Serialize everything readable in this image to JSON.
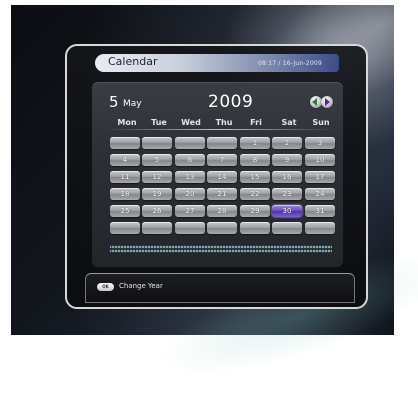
{
  "window": {
    "title": "Calendar",
    "clock": "08:17 / 16-Jun-2009"
  },
  "calendar": {
    "day": "5",
    "month": "May",
    "year": "2009",
    "weekdays": [
      "Mon",
      "Tue",
      "Wed",
      "Thu",
      "Fri",
      "Sat",
      "Sun"
    ],
    "weeks": [
      [
        "",
        "",
        "",
        "",
        "1",
        "2",
        "3"
      ],
      [
        "4",
        "5",
        "6",
        "7",
        "8",
        "9",
        "10"
      ],
      [
        "11",
        "12",
        "13",
        "14",
        "15",
        "16",
        "17"
      ],
      [
        "18",
        "19",
        "20",
        "21",
        "22",
        "23",
        "24"
      ],
      [
        "25",
        "26",
        "27",
        "28",
        "29",
        "30",
        "31"
      ],
      [
        "",
        "",
        "",
        "",
        "",
        "",
        ""
      ]
    ],
    "selected_date": "30",
    "nav_icons": [
      "prev-year-icon",
      "next-year-icon"
    ]
  },
  "footer": {
    "key_icon": "remote-key-icon",
    "action_label": "Change Year"
  },
  "colors": {
    "selected_cell": "#6b4fc4",
    "title_bar_accent": "#3c4c86"
  }
}
